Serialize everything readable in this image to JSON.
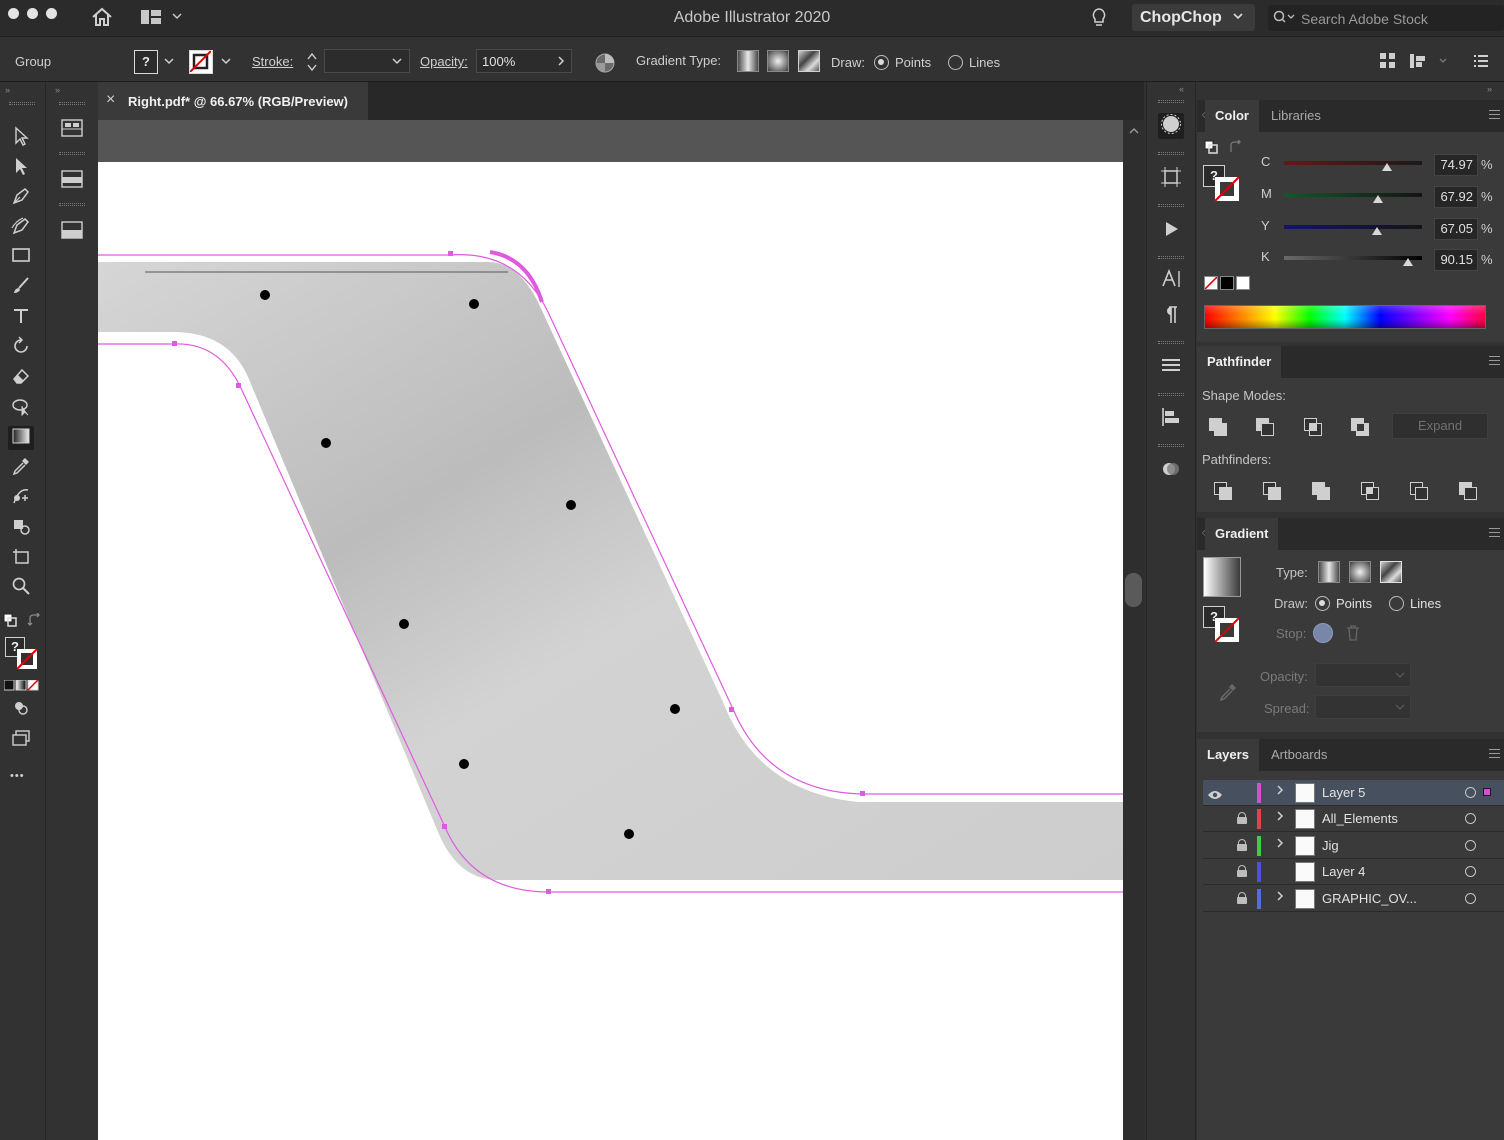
{
  "app": {
    "title": "Adobe Illustrator 2020",
    "workspace": "ChopChop",
    "search_placeholder": "Search Adobe Stock"
  },
  "control_bar": {
    "selection_label": "Group",
    "fill_question": "?",
    "stroke_label": "Stroke:",
    "opacity_label": "Opacity:",
    "opacity_value": "100%",
    "gradient_type_label": "Gradient Type:",
    "draw_label": "Draw:",
    "draw_points": "Points",
    "draw_lines": "Lines"
  },
  "document": {
    "tab_title": "Right.pdf* @ 66.67% (RGB/Preview)",
    "close_glyph": "×"
  },
  "color_panel": {
    "tabs": [
      "Color",
      "Libraries"
    ],
    "channels": [
      {
        "label": "C",
        "value": "74.97",
        "fraction": 0.7497,
        "color": "#00b8e6"
      },
      {
        "label": "M",
        "value": "67.92",
        "fraction": 0.6792,
        "color": "#e6008a"
      },
      {
        "label": "Y",
        "value": "67.05",
        "fraction": 0.6705,
        "color": "#f2e600"
      },
      {
        "label": "K",
        "value": "90.15",
        "fraction": 0.9015,
        "color": "#000000"
      }
    ],
    "percent": "%",
    "question": "?"
  },
  "pathfinder_panel": {
    "title": "Pathfinder",
    "shape_modes_label": "Shape Modes:",
    "pathfinders_label": "Pathfinders:",
    "expand_label": "Expand"
  },
  "gradient_panel": {
    "title": "Gradient",
    "type_label": "Type:",
    "draw_label": "Draw:",
    "draw_points": "Points",
    "draw_lines": "Lines",
    "stop_label": "Stop:",
    "opacity_label": "Opacity:",
    "spread_label": "Spread:",
    "question": "?"
  },
  "layers_panel": {
    "tabs": [
      "Layers",
      "Artboards"
    ],
    "layers": [
      {
        "name": "Layer 5",
        "color": "#d34fd3",
        "selected": true,
        "locked": false,
        "visible": true,
        "expandable": true
      },
      {
        "name": "All_Elements",
        "color": "#e04545",
        "selected": false,
        "locked": true,
        "visible": false,
        "expandable": true
      },
      {
        "name": "Jig",
        "color": "#3fcf3f",
        "selected": false,
        "locked": true,
        "visible": false,
        "expandable": true
      },
      {
        "name": "Layer 4",
        "color": "#4f4fe0",
        "selected": false,
        "locked": true,
        "visible": false,
        "expandable": false
      },
      {
        "name": "GRAPHIC_OV...",
        "color": "#4f6fe0",
        "selected": false,
        "locked": true,
        "visible": false,
        "expandable": true
      }
    ]
  },
  "toolbar": {
    "more_glyph": "•••",
    "question": "?"
  },
  "colors": {
    "accent_path": "#e05ae0",
    "selection": "#46505e"
  }
}
